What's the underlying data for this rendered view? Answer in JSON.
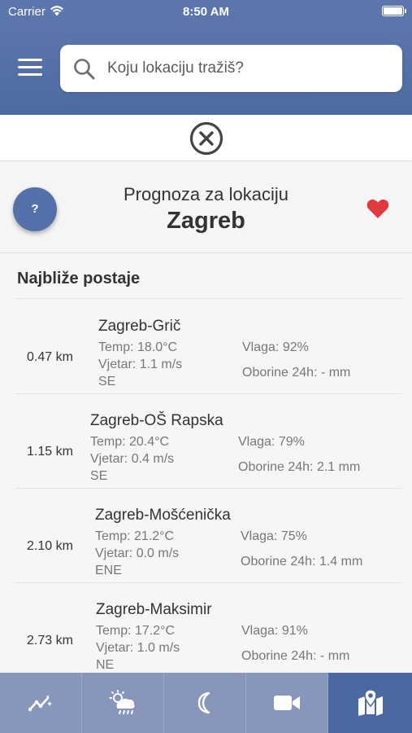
{
  "status_bar": {
    "carrier": "Carrier",
    "time": "8:50 AM"
  },
  "search": {
    "placeholder": "Koju lokaciju tražiš?",
    "value": ""
  },
  "forecast": {
    "help_label": "?",
    "subtitle": "Prognoza za lokaciju",
    "city": "Zagreb"
  },
  "stations": {
    "title": "Najbliže postaje",
    "items": [
      {
        "distance": "0.47 km",
        "name": "Zagreb-Grič",
        "temp": "Temp: 18.0°C",
        "wind": "Vjetar: 1.1 m/s",
        "dir": "SE",
        "humidity": "Vlaga: 92%",
        "precip": "Oborine 24h: - mm"
      },
      {
        "distance": "1.15 km",
        "name": "Zagreb-OŠ Rapska",
        "temp": "Temp: 20.4°C",
        "wind": "Vjetar: 0.4 m/s",
        "dir": "SE",
        "humidity": "Vlaga: 79%",
        "precip": "Oborine 24h: 2.1 mm"
      },
      {
        "distance": "2.10 km",
        "name": "Zagreb-Mošćenička",
        "temp": "Temp: 21.2°C",
        "wind": "Vjetar: 0.0 m/s",
        "dir": "ENE",
        "humidity": "Vlaga: 75%",
        "precip": "Oborine 24h: 1.4 mm"
      },
      {
        "distance": "2.73 km",
        "name": "Zagreb-Maksimir",
        "temp": "Temp: 17.2°C",
        "wind": "Vjetar: 1.0 m/s",
        "dir": "NE",
        "humidity": "Vlaga: 91%",
        "precip": "Oborine 24h: - mm"
      }
    ]
  },
  "tabs": [
    {
      "icon": "trend-chart-icon",
      "active": false
    },
    {
      "icon": "cloud-sun-rain-icon",
      "active": false
    },
    {
      "icon": "moon-icon",
      "active": false
    },
    {
      "icon": "video-camera-icon",
      "active": false
    },
    {
      "icon": "map-marker-icon",
      "active": true
    }
  ],
  "colors": {
    "header": "#5b76ac",
    "tabbar": "#8796ba",
    "tab_active": "#4c68a1",
    "heart": "#e0393e",
    "help_button": "#5470a8"
  }
}
